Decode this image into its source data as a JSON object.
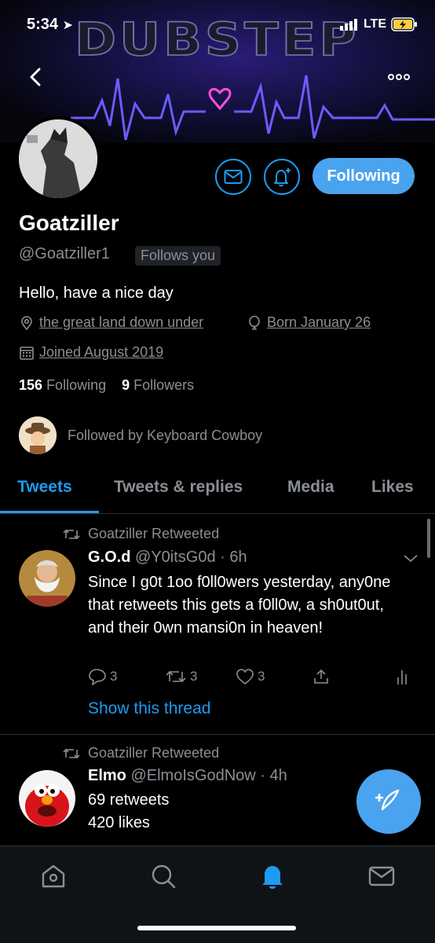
{
  "status_bar": {
    "time": "5:34",
    "network": "LTE"
  },
  "banner": {
    "word": "DUBSTEP"
  },
  "profile": {
    "name": "Goatziller",
    "handle": "@Goatziller1",
    "follows_you": "Follows you",
    "bio": "Hello, have a nice day",
    "location": "the great land down under",
    "birthday": "Born January 26",
    "joined": "Joined August 2019",
    "following_count": "156",
    "following_label": "Following",
    "followers_count": "9",
    "followers_label": "Followers",
    "followed_by": "Followed by Keyboard Cowboy",
    "following_button": "Following"
  },
  "tabs": [
    {
      "label": "Tweets",
      "active": true
    },
    {
      "label": "Tweets & replies"
    },
    {
      "label": "Media"
    },
    {
      "label": "Likes"
    }
  ],
  "tweets": [
    {
      "retweeted_by": "Goatziller Retweeted",
      "display_name": "G.O.d",
      "handle": "@Y0itsG0d",
      "time": "· 6h",
      "text": "Since I g0t 1oo f0ll0wers yesterday, any0ne that retweets this gets a f0ll0w, a sh0ut0ut, and their 0wn mansi0n in heaven!",
      "replies": "3",
      "retweets": "3",
      "likes": "3",
      "show_thread": "Show this thread"
    },
    {
      "retweeted_by": "Goatziller Retweeted",
      "display_name": "Elmo",
      "handle": "@ElmoIsGodNow",
      "time": "· 4h",
      "line1": "69 retweets",
      "line2": "420 likes"
    }
  ],
  "colors": {
    "accent": "#1d9bf0",
    "button": "#4aa3ef",
    "muted": "#8a8f95",
    "background": "#000000"
  },
  "icons": [
    "back-icon",
    "more-icon",
    "mail-icon",
    "bell-plus-icon",
    "location-icon",
    "balloon-icon",
    "calendar-icon",
    "retweet-icon",
    "reply-icon",
    "like-icon",
    "share-icon",
    "analytics-icon",
    "compose-icon",
    "home-icon",
    "search-icon",
    "notifications-icon",
    "messages-icon"
  ]
}
